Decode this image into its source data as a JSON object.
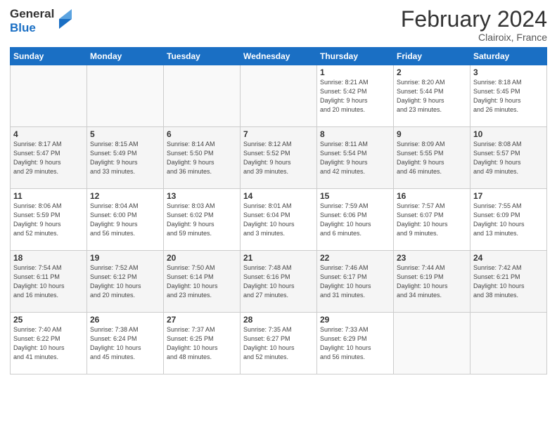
{
  "header": {
    "logo_line1": "General",
    "logo_line2": "Blue",
    "month_title": "February 2024",
    "location": "Clairoix, France"
  },
  "weekdays": [
    "Sunday",
    "Monday",
    "Tuesday",
    "Wednesday",
    "Thursday",
    "Friday",
    "Saturday"
  ],
  "weeks": [
    [
      {
        "day": "",
        "info": ""
      },
      {
        "day": "",
        "info": ""
      },
      {
        "day": "",
        "info": ""
      },
      {
        "day": "",
        "info": ""
      },
      {
        "day": "1",
        "info": "Sunrise: 8:21 AM\nSunset: 5:42 PM\nDaylight: 9 hours\nand 20 minutes."
      },
      {
        "day": "2",
        "info": "Sunrise: 8:20 AM\nSunset: 5:44 PM\nDaylight: 9 hours\nand 23 minutes."
      },
      {
        "day": "3",
        "info": "Sunrise: 8:18 AM\nSunset: 5:45 PM\nDaylight: 9 hours\nand 26 minutes."
      }
    ],
    [
      {
        "day": "4",
        "info": "Sunrise: 8:17 AM\nSunset: 5:47 PM\nDaylight: 9 hours\nand 29 minutes."
      },
      {
        "day": "5",
        "info": "Sunrise: 8:15 AM\nSunset: 5:49 PM\nDaylight: 9 hours\nand 33 minutes."
      },
      {
        "day": "6",
        "info": "Sunrise: 8:14 AM\nSunset: 5:50 PM\nDaylight: 9 hours\nand 36 minutes."
      },
      {
        "day": "7",
        "info": "Sunrise: 8:12 AM\nSunset: 5:52 PM\nDaylight: 9 hours\nand 39 minutes."
      },
      {
        "day": "8",
        "info": "Sunrise: 8:11 AM\nSunset: 5:54 PM\nDaylight: 9 hours\nand 42 minutes."
      },
      {
        "day": "9",
        "info": "Sunrise: 8:09 AM\nSunset: 5:55 PM\nDaylight: 9 hours\nand 46 minutes."
      },
      {
        "day": "10",
        "info": "Sunrise: 8:08 AM\nSunset: 5:57 PM\nDaylight: 9 hours\nand 49 minutes."
      }
    ],
    [
      {
        "day": "11",
        "info": "Sunrise: 8:06 AM\nSunset: 5:59 PM\nDaylight: 9 hours\nand 52 minutes."
      },
      {
        "day": "12",
        "info": "Sunrise: 8:04 AM\nSunset: 6:00 PM\nDaylight: 9 hours\nand 56 minutes."
      },
      {
        "day": "13",
        "info": "Sunrise: 8:03 AM\nSunset: 6:02 PM\nDaylight: 9 hours\nand 59 minutes."
      },
      {
        "day": "14",
        "info": "Sunrise: 8:01 AM\nSunset: 6:04 PM\nDaylight: 10 hours\nand 3 minutes."
      },
      {
        "day": "15",
        "info": "Sunrise: 7:59 AM\nSunset: 6:06 PM\nDaylight: 10 hours\nand 6 minutes."
      },
      {
        "day": "16",
        "info": "Sunrise: 7:57 AM\nSunset: 6:07 PM\nDaylight: 10 hours\nand 9 minutes."
      },
      {
        "day": "17",
        "info": "Sunrise: 7:55 AM\nSunset: 6:09 PM\nDaylight: 10 hours\nand 13 minutes."
      }
    ],
    [
      {
        "day": "18",
        "info": "Sunrise: 7:54 AM\nSunset: 6:11 PM\nDaylight: 10 hours\nand 16 minutes."
      },
      {
        "day": "19",
        "info": "Sunrise: 7:52 AM\nSunset: 6:12 PM\nDaylight: 10 hours\nand 20 minutes."
      },
      {
        "day": "20",
        "info": "Sunrise: 7:50 AM\nSunset: 6:14 PM\nDaylight: 10 hours\nand 23 minutes."
      },
      {
        "day": "21",
        "info": "Sunrise: 7:48 AM\nSunset: 6:16 PM\nDaylight: 10 hours\nand 27 minutes."
      },
      {
        "day": "22",
        "info": "Sunrise: 7:46 AM\nSunset: 6:17 PM\nDaylight: 10 hours\nand 31 minutes."
      },
      {
        "day": "23",
        "info": "Sunrise: 7:44 AM\nSunset: 6:19 PM\nDaylight: 10 hours\nand 34 minutes."
      },
      {
        "day": "24",
        "info": "Sunrise: 7:42 AM\nSunset: 6:21 PM\nDaylight: 10 hours\nand 38 minutes."
      }
    ],
    [
      {
        "day": "25",
        "info": "Sunrise: 7:40 AM\nSunset: 6:22 PM\nDaylight: 10 hours\nand 41 minutes."
      },
      {
        "day": "26",
        "info": "Sunrise: 7:38 AM\nSunset: 6:24 PM\nDaylight: 10 hours\nand 45 minutes."
      },
      {
        "day": "27",
        "info": "Sunrise: 7:37 AM\nSunset: 6:25 PM\nDaylight: 10 hours\nand 48 minutes."
      },
      {
        "day": "28",
        "info": "Sunrise: 7:35 AM\nSunset: 6:27 PM\nDaylight: 10 hours\nand 52 minutes."
      },
      {
        "day": "29",
        "info": "Sunrise: 7:33 AM\nSunset: 6:29 PM\nDaylight: 10 hours\nand 56 minutes."
      },
      {
        "day": "",
        "info": ""
      },
      {
        "day": "",
        "info": ""
      }
    ]
  ]
}
